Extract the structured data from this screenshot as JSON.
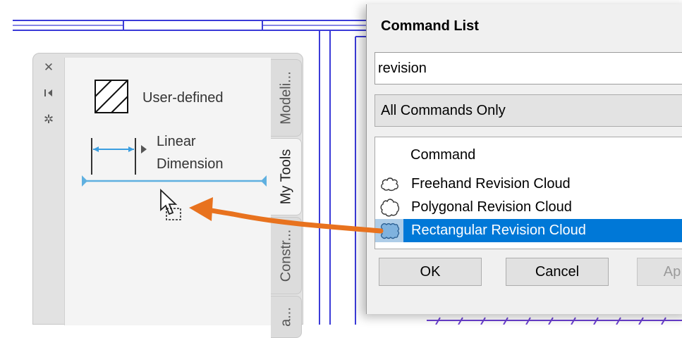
{
  "palette": {
    "side_icons": [
      "close-icon",
      "auto-hide-icon",
      "properties-icon"
    ],
    "tools": [
      {
        "label": "User-defined",
        "icon": "hatch-icon"
      },
      {
        "label_line1": "Linear",
        "label_line2": "Dimension",
        "icon": "linear-dimension-icon"
      }
    ],
    "tabs": [
      "Modeli...",
      "My Tools",
      "Constr...",
      "a..."
    ],
    "active_tab": "My Tools"
  },
  "dialog": {
    "title": "Command List",
    "search_value": "revision",
    "filter_selected": "All Commands Only",
    "list_header": "Command",
    "commands": [
      {
        "label": "Freehand Revision Cloud",
        "icon": "freehand-cloud-icon",
        "selected": false
      },
      {
        "label": "Polygonal Revision Cloud",
        "icon": "polygonal-cloud-icon",
        "selected": false
      },
      {
        "label": "Rectangular Revision Cloud",
        "icon": "rectangular-cloud-icon",
        "selected": true
      }
    ],
    "buttons": {
      "ok": "OK",
      "cancel": "Cancel",
      "apply": "Ap"
    }
  },
  "colors": {
    "cad_lines": "#3b3bd8",
    "drag_arrow": "#e8721e",
    "selection": "#0078d7",
    "dimension_line": "#5fb0e0"
  }
}
